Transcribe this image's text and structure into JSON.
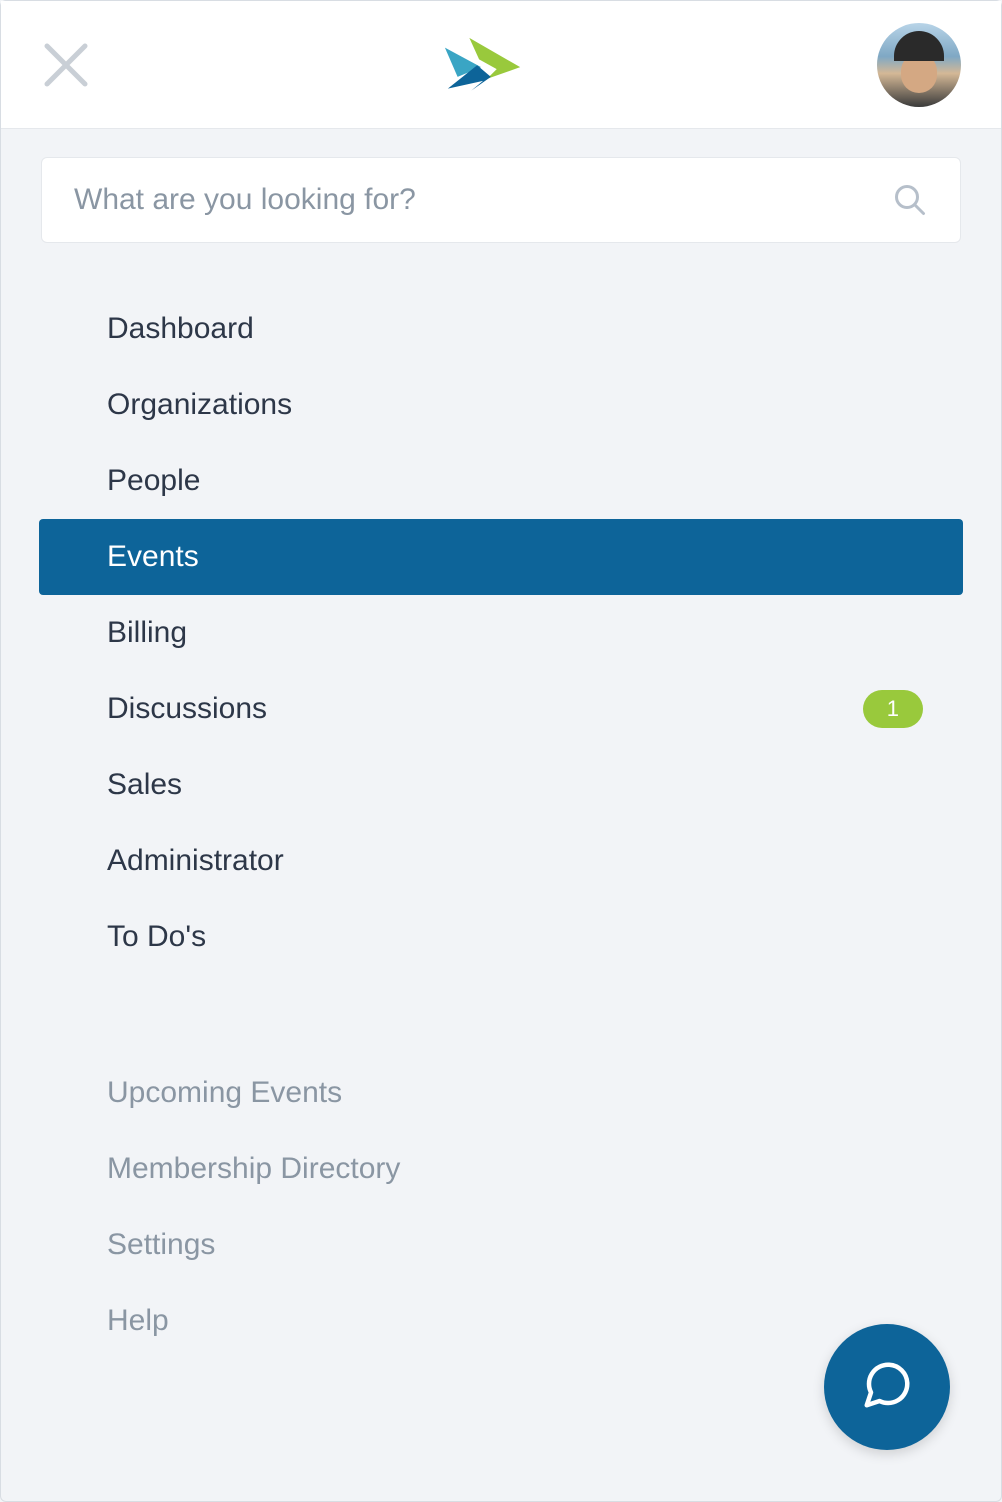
{
  "search": {
    "placeholder": "What are you looking for?"
  },
  "nav": {
    "items": [
      {
        "label": "Dashboard",
        "active": false
      },
      {
        "label": "Organizations",
        "active": false
      },
      {
        "label": "People",
        "active": false
      },
      {
        "label": "Events",
        "active": true
      },
      {
        "label": "Billing",
        "active": false
      },
      {
        "label": "Discussions",
        "active": false,
        "badge": "1"
      },
      {
        "label": "Sales",
        "active": false
      },
      {
        "label": "Administrator",
        "active": false
      },
      {
        "label": "To Do's",
        "active": false
      }
    ]
  },
  "secondary": {
    "items": [
      {
        "label": "Upcoming Events"
      },
      {
        "label": "Membership Directory"
      },
      {
        "label": "Settings"
      },
      {
        "label": "Help"
      }
    ]
  },
  "colors": {
    "brand_primary": "#0d6499",
    "brand_teal": "#3aa5c4",
    "brand_green": "#99c93c",
    "text_primary": "#2d3748",
    "text_muted": "#8a96a3"
  }
}
